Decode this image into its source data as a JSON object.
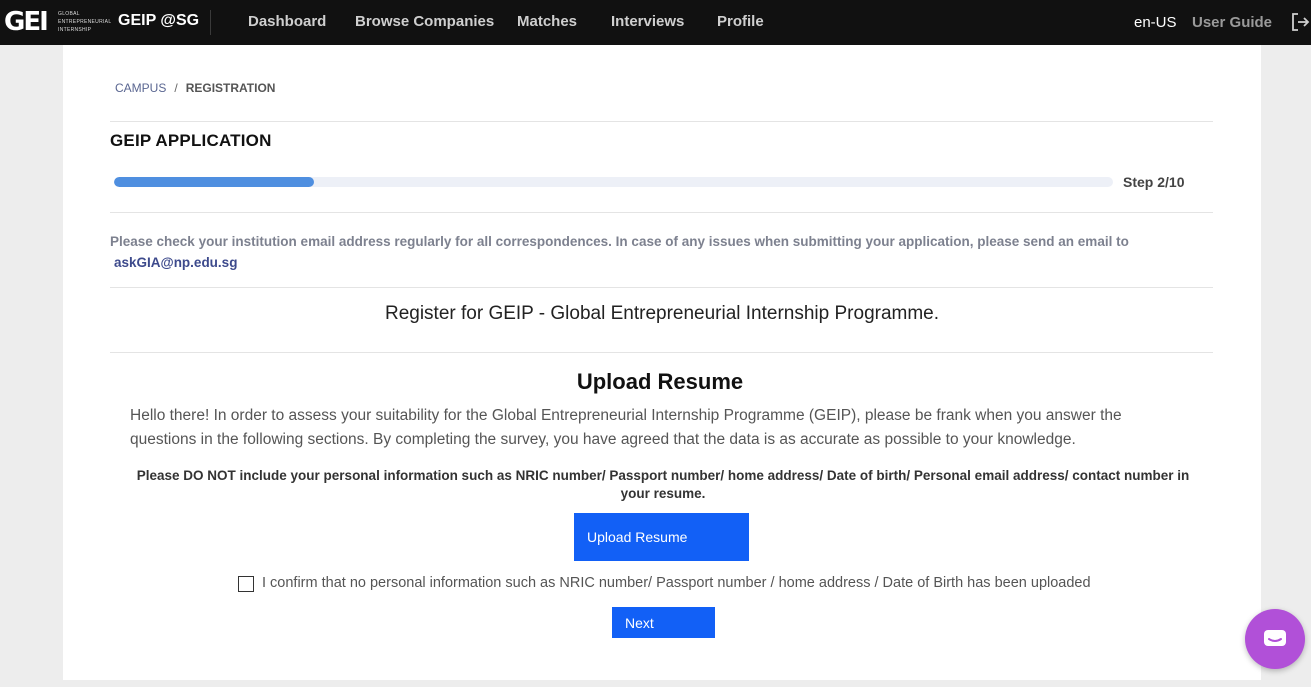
{
  "topbar": {
    "logo_mark": "GEI",
    "logo_sub": [
      "GLOBAL",
      "ENTREPRENEURIAL",
      "INTERNSHIP"
    ],
    "brand": "GEIP @SG",
    "nav": [
      "Dashboard",
      "Browse Companies",
      "Matches",
      "Interviews",
      "Profile"
    ],
    "locale": "en-US",
    "user_guide": "User Guide",
    "logout_icon": "logout-icon"
  },
  "breadcrumb": {
    "parent": "CAMPUS",
    "separator": "/",
    "current": "REGISTRATION"
  },
  "application": {
    "title": "GEIP APPLICATION",
    "progress": {
      "step": 2,
      "total": 10,
      "label": "Step 2/10"
    },
    "notice": "Please check your institution email address regularly for all correspondences. In case of any issues when submitting your application, please send an email to",
    "email": "askGIA@np.edu.sg",
    "subtitle": "Register for GEIP - Global Entrepreneurial Internship Programme."
  },
  "resume": {
    "heading": "Upload Resume",
    "intro": "Hello there! In order to assess your suitability for the Global Entrepreneurial Internship Programme (GEIP), please be frank when you answer the questions in the following sections. By completing the survey, you have agreed that the data is as accurate as possible to your knowledge.",
    "warning": "Please DO NOT include your personal information such as NRIC number/ Passport number/ home address/ Date of birth/ Personal email address/ contact number in your resume.",
    "upload_button": "Upload Resume",
    "confirm_label": "I confirm that no personal information such as NRIC number/ Passport number / home address / Date of Birth has been uploaded",
    "confirm_checked": false,
    "next_button": "Next"
  },
  "colors": {
    "topbar": "#111111",
    "primary_button": "#1260f6",
    "progress_fill": "#4f8fe0",
    "chat": "#b150d8"
  },
  "chat_icon": "chat-icon"
}
